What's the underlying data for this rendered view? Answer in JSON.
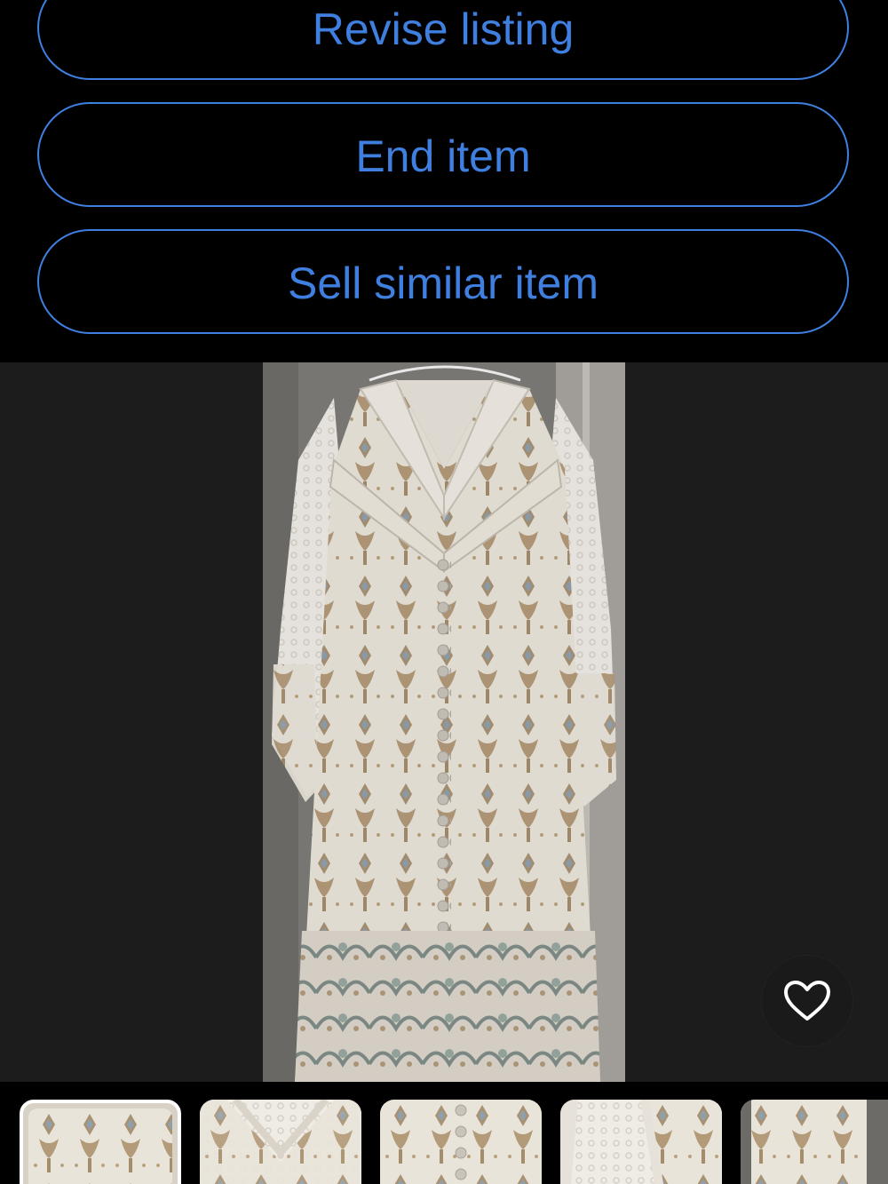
{
  "actions": {
    "revise_label": "Revise listing",
    "end_label": "End item",
    "sell_similar_label": "Sell similar item"
  },
  "gallery": {
    "favorite_icon": "heart-outline-icon",
    "selected_thumbnail_index": 0,
    "thumbnail_count_visible": 5
  },
  "colors": {
    "accent": "#3f7fe0",
    "background": "#000000",
    "gallery_background": "#1c1c1c"
  }
}
